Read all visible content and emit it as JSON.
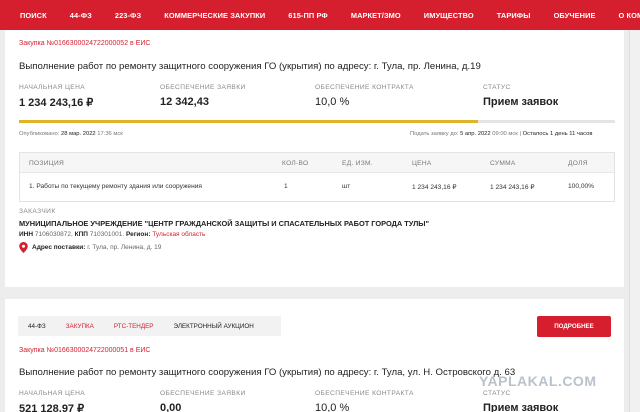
{
  "nav": {
    "items": [
      "ПОИСК",
      "44-ФЗ",
      "223-ФЗ",
      "КОММЕРЧЕСКИЕ ЗАКУПКИ",
      "615-ПП РФ",
      "МАРКЕТ/ЗМО",
      "ИМУЩЕСТВО",
      "ТАРИФЫ",
      "ОБУЧЕНИЕ",
      "О КОМПАНИИ"
    ]
  },
  "card1": {
    "reg_number": "Закупка №0166300024722000052 в ЕИС",
    "title": "Выполнение работ по ремонту защитного сооружения ГО (укрытия) по адресу: г. Тула, пр. Ленина, д.19",
    "price_label": "НАЧАЛЬНАЯ ЦЕНА",
    "price_value": "1 234 243,16 ₽",
    "bid_security_label": "ОБЕСПЕЧЕНИЕ ЗАЯВКИ",
    "bid_security_value": "12 342,43",
    "contract_security_label": "ОБЕСПЕЧЕНИЕ КОНТРАКТА",
    "contract_security_value": "10,0 %",
    "status_label": "СТАТУС",
    "status_value": "Прием заявок",
    "progress": 0.77,
    "published_label": "Опубликовано:",
    "published_date": "28 мар. 2022",
    "published_time": "17:36 мск",
    "deadline_label": "Подать заявку до:",
    "deadline_date": "5 апр. 2022",
    "deadline_time": "09:00 мск",
    "remaining_sep": "|",
    "remaining": "Осталось 1 день 11 часов",
    "table": {
      "headers": [
        "ПОЗИЦИЯ",
        "КОЛ-ВО",
        "ЕД. ИЗМ.",
        "ЦЕНА",
        "СУММА",
        "ДОЛЯ"
      ],
      "row": [
        "1. Работы по текущему ремонту здания или сооружения",
        "1",
        "шт",
        "1 234 243,16 ₽",
        "1 234 243,16 ₽",
        "100,00%"
      ]
    },
    "customer_label": "ЗАКАЗЧИК",
    "customer_name": "МУНИЦИПАЛЬНОЕ УЧРЕЖДЕНИЕ \"ЦЕНТР ГРАЖДАНСКОЙ ЗАЩИТЫ И СПАСАТЕЛЬНЫХ РАБОТ ГОРОДА ТУЛЫ\"",
    "inn_label": "ИНН",
    "inn": "7106030872,",
    "kpp_label": "КПП",
    "kpp": "710301001.",
    "region_label": "Регион:",
    "region": "Тульская область",
    "address_label": "Адрес поставки:",
    "address": "г. Тула, пр. Ленина, д. 19",
    "pin_icon": "location-pin-icon",
    "accent_color": "#d51f2e",
    "progress_color": "#e0b32a"
  },
  "card2": {
    "tabs": [
      "44-ФЗ",
      "ЗАКУПКА",
      "РТС-ТЕНДЕР",
      "ЭЛЕКТРОННЫЙ АУКЦИОН"
    ],
    "details_button": "ПОДРОБНЕЕ",
    "reg_number": "Закупка №0166300024722000051 в ЕИС",
    "title": "Выполнение работ по ремонту защитного сооружения ГО (укрытия) по адресу: г. Тула, ул. Н. Островского д. 63",
    "price_label": "НАЧАЛЬНАЯ ЦЕНА",
    "price_value": "521 128,97 ₽",
    "bid_security_label": "ОБЕСПЕЧЕНИЕ ЗАЯВКИ",
    "bid_security_value": "0,00",
    "contract_security_label": "ОБЕСПЕЧЕНИЕ КОНТРАКТА",
    "contract_security_value": "10,0 %",
    "status_label": "СТАТУС",
    "status_value": "Прием заявок"
  },
  "watermark": "YAPLAKAL.COM"
}
